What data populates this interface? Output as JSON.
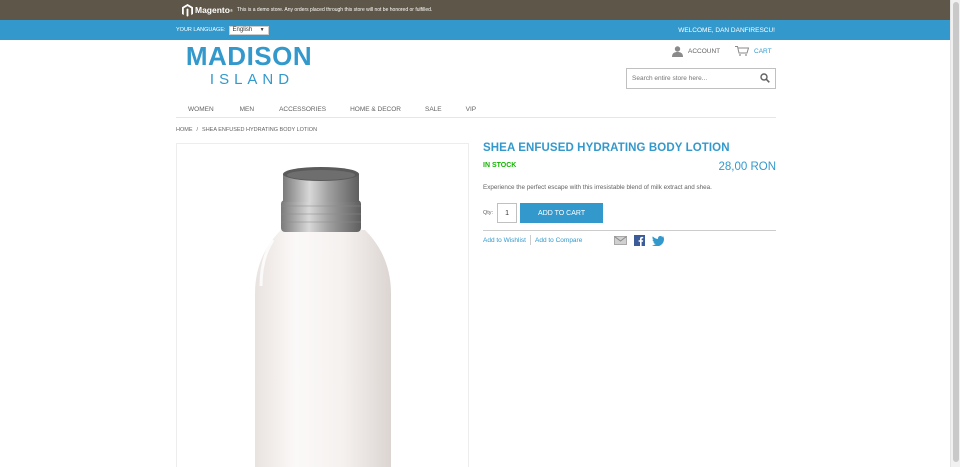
{
  "demo_notice": {
    "logo_text": "Magento",
    "logo_superscript": "®",
    "message": "This is a demo store. Any orders placed through this store will not be honored or fulfilled."
  },
  "header": {
    "language_label": "Your Language:",
    "language_value": "English",
    "welcome": "Welcome, DAN DANFIRESCU!"
  },
  "logo": {
    "line1": "MADISON",
    "line2": "ISLAND"
  },
  "account_label": "Account",
  "cart_label": "Cart",
  "search": {
    "placeholder": "Search entire store here..."
  },
  "nav": {
    "items": [
      {
        "label": "Women"
      },
      {
        "label": "Men"
      },
      {
        "label": "Accessories"
      },
      {
        "label": "Home & Decor"
      },
      {
        "label": "Sale"
      },
      {
        "label": "VIP"
      }
    ]
  },
  "breadcrumbs": {
    "home": "Home",
    "separator": "/",
    "current": "Shea Enfused Hydrating Body Lotion"
  },
  "product": {
    "name": "SHEA ENFUSED HYDRATING BODY LOTION",
    "stock": "IN STOCK",
    "price": "28,00 RON",
    "description": "Experience the perfect escape with this irresistable blend of milk extract and shea.",
    "qty_label": "Qty:",
    "qty_value": "1",
    "add_to_cart": "Add to Cart",
    "wishlist": "Add to Wishlist",
    "compare": "Add to Compare"
  },
  "colors": {
    "brand_blue": "#3399cc",
    "demo_bar": "#5e5648",
    "in_stock_green": "#11b400"
  },
  "icons": [
    "magento-icon",
    "account-icon",
    "cart-icon",
    "search-icon",
    "email-icon",
    "facebook-icon",
    "twitter-icon"
  ]
}
